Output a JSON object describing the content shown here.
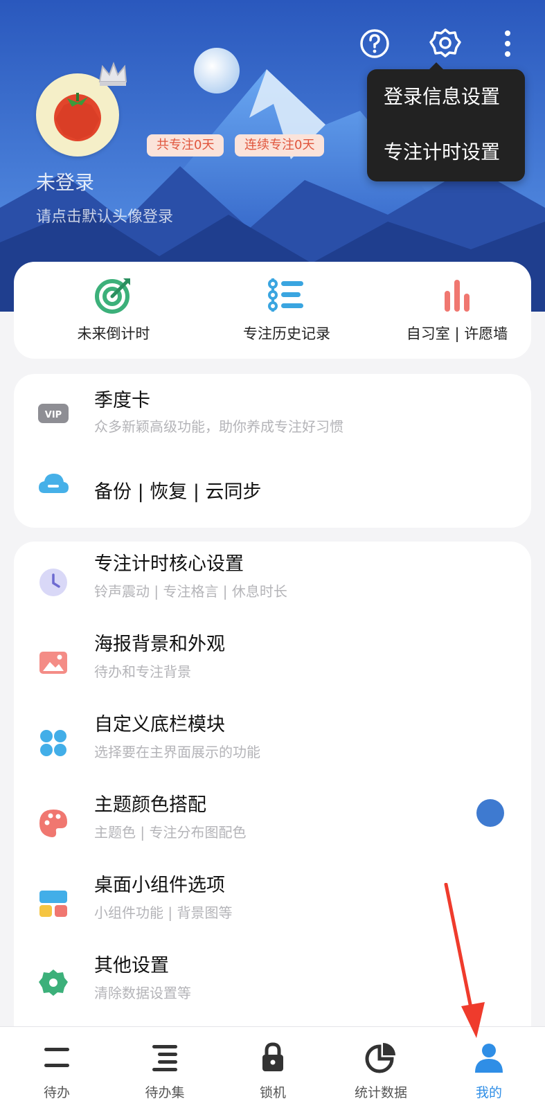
{
  "header": {
    "login_name": "未登录",
    "login_hint": "请点击默认头像登录",
    "badge_total": "共专注0天",
    "badge_streak": "连续专注0天",
    "icons": [
      "help-icon",
      "gear-icon",
      "more-vertical-icon"
    ]
  },
  "popup_menu": {
    "items": [
      "登录信息设置",
      "专注计时设置"
    ]
  },
  "quick_actions": [
    {
      "label": "未来倒计时",
      "icon": "target-icon",
      "color": "#3cb07a"
    },
    {
      "label": "专注历史记录",
      "icon": "list-icon",
      "color": "#3aa5e0"
    },
    {
      "label": "自习室 | 许愿墙",
      "icon": "bars-icon",
      "color": "#f07770"
    }
  ],
  "vip_section": {
    "vip_badge": "VIP",
    "title": "季度卡",
    "subtitle": "众多新颖高级功能，助你养成专注好习惯",
    "backup_title": "备份 | 恢复 | 云同步"
  },
  "settings": [
    {
      "title": "专注计时核心设置",
      "subtitle": "铃声震动 | 专注格言 | 休息时长",
      "icon": "clock-icon"
    },
    {
      "title": "海报背景和外观",
      "subtitle": "待办和专注背景",
      "icon": "image-icon"
    },
    {
      "title": "自定义底栏模块",
      "subtitle": "选择要在主界面展示的功能",
      "icon": "clover-icon"
    },
    {
      "title": "主题颜色搭配",
      "subtitle": "主题色 | 专注分布图配色",
      "icon": "palette-icon"
    },
    {
      "title": "桌面小组件选项",
      "subtitle": "小组件功能 | 背景图等",
      "icon": "widget-icon"
    },
    {
      "title": "其他设置",
      "subtitle": "清除数据设置等",
      "icon": "gear-icon"
    }
  ],
  "theme_color": "#3e7ad0",
  "bottom_nav": [
    {
      "label": "待办",
      "icon": "todo-icon"
    },
    {
      "label": "待办集",
      "icon": "todo-list-icon"
    },
    {
      "label": "锁机",
      "icon": "lock-icon"
    },
    {
      "label": "统计数据",
      "icon": "pie-chart-icon"
    },
    {
      "label": "我的",
      "icon": "user-icon",
      "active": true
    }
  ],
  "accent_color": "#2f8ee6"
}
